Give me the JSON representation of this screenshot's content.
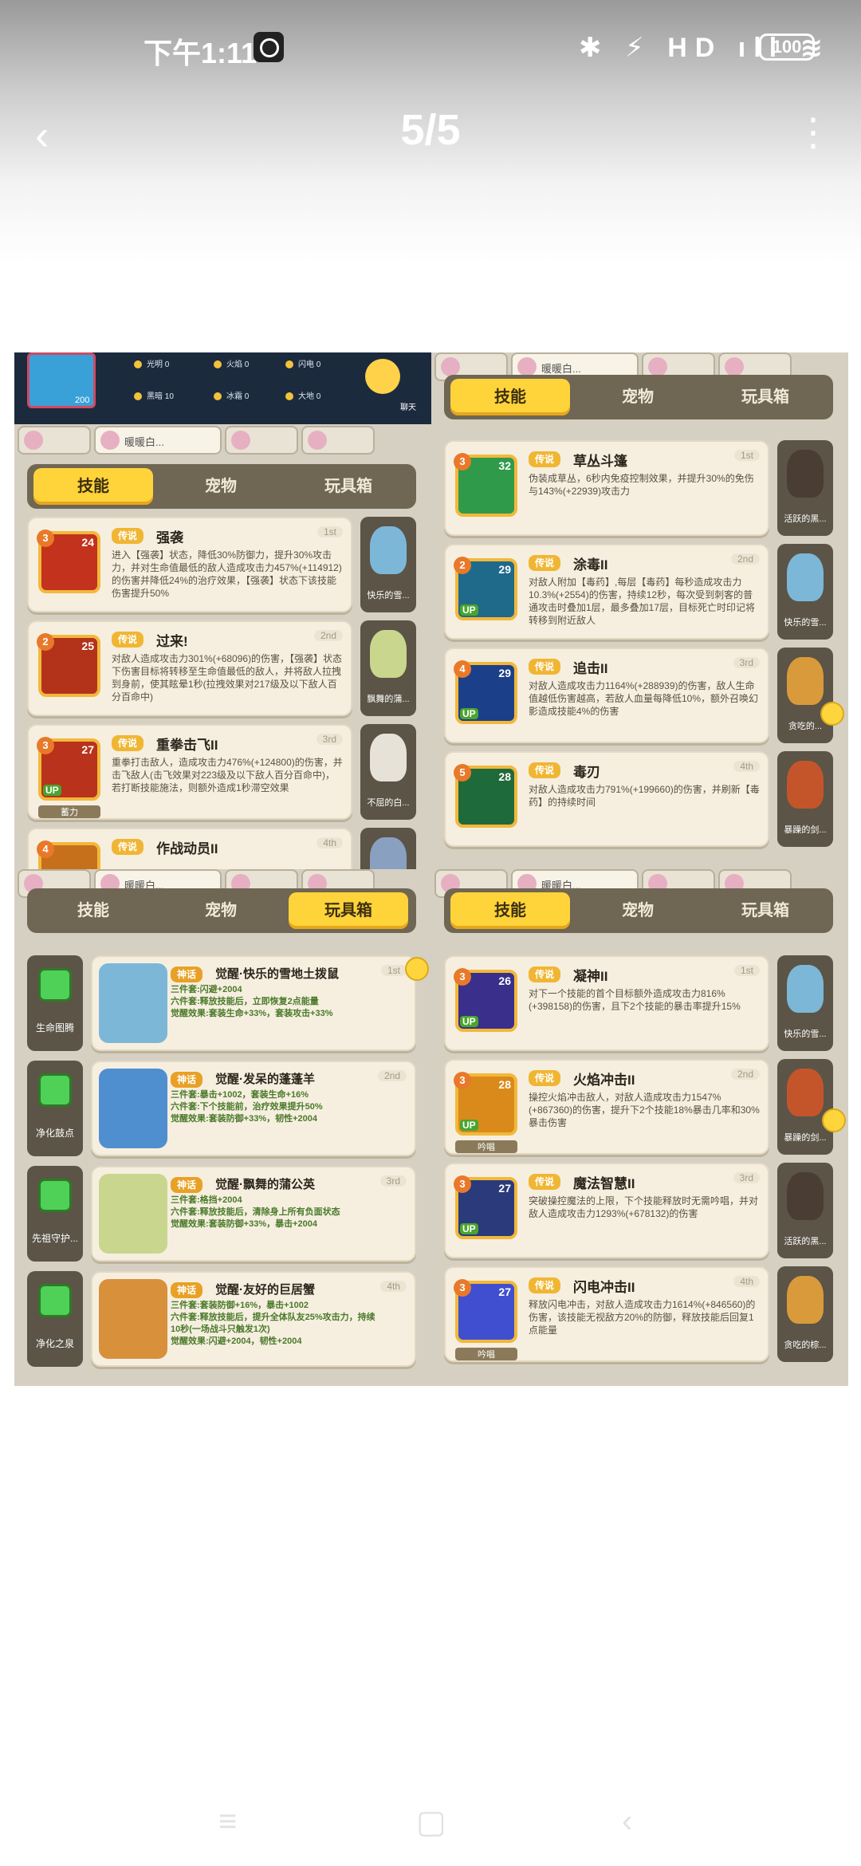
{
  "status_bar": {
    "time": "下午1:11",
    "signal_icons": "✱ ⚡ HD ıll ≋",
    "battery": "100"
  },
  "header": {
    "back_icon": "back-chevron",
    "title": "5/5",
    "more_icon": "vertical-ellipsis"
  },
  "panels": [
    {
      "hud": {
        "avatar_value": "200",
        "stats": [
          "光明 0",
          "火焰 0",
          "闪电 0",
          "黑暗 10",
          "冰霜 0",
          "大地 0"
        ],
        "tag": "聊天"
      },
      "pet_tab_name": "暖暖白...",
      "tabs": [
        "技能",
        "宠物",
        "玩具箱"
      ],
      "active_tab": 0,
      "cards": [
        {
          "level": "3",
          "num": "24",
          "up": "",
          "sub": "",
          "badge": "传说",
          "title": "强袭",
          "rank": "1st",
          "desc": "进入【强袭】状态，降低30%防御力，提升30%攻击力，并对生命值最低的敌人造成攻击力457%(+114912)的伤害并降低24%的治疗效果，【强袭】状态下该技能伤害提升50%",
          "pet": "快乐的雪...",
          "pet_color": "#7db7d8",
          "icon_color": "#c2321c"
        },
        {
          "level": "2",
          "num": "25",
          "up": "",
          "sub": "",
          "badge": "传说",
          "title": "过来!",
          "rank": "2nd",
          "desc": "对敌人造成攻击力301%(+68096)的伤害，【强袭】状态下伤害目标将转移至生命值最低的敌人，并将敌人拉拽到身前，使其眩晕1秒(拉拽效果对217级及以下敌人百分百命中)",
          "pet": "飘舞的蒲...",
          "pet_color": "#c9d68e",
          "icon_color": "#b3331a"
        },
        {
          "level": "3",
          "num": "27",
          "up": "UP",
          "sub": "蓄力",
          "badge": "传说",
          "title": "重拳击飞II",
          "rank": "3rd",
          "desc": "重拳打击敌人，造成攻击力476%(+124800)的伤害，并击飞敌人(击飞效果对223级及以下敌人百分百命中)，若打断技能施法，则额外造成1秒滞空效果",
          "pet": "不屈的白...",
          "pet_color": "#e7e2d8",
          "icon_color": "#b8321c"
        },
        {
          "level": "4",
          "num": "",
          "up": "",
          "sub": "",
          "badge": "传说",
          "title": "作战动员II",
          "rank": "4th",
          "desc": "",
          "pet": "",
          "pet_color": "#8aa0c0",
          "icon_color": "#c7701c"
        }
      ]
    },
    {
      "pet_tab_name": "暖暖白...",
      "tabs": [
        "技能",
        "宠物",
        "玩具箱"
      ],
      "active_tab": 0,
      "cards": [
        {
          "level": "3",
          "num": "32",
          "up": "",
          "sub": "",
          "badge": "传说",
          "title": "草丛斗篷",
          "rank": "1st",
          "desc": "伪装成草丛，6秒内免疫控制效果，并提升30%的免伤与143%(+22939)攻击力",
          "pet": "活跃的黑...",
          "pet_color": "#4a3d34",
          "icon_color": "#2f9a4a"
        },
        {
          "level": "2",
          "num": "29",
          "up": "UP",
          "sub": "",
          "badge": "传说",
          "title": "涂毒II",
          "rank": "2nd",
          "desc": "对敌人附加【毒药】,每层【毒药】每秒造成攻击力10.3%(+2554)的伤害，持续12秒，每次受到刺客的普通攻击时叠加1层，最多叠加17层，目标死亡时印记将转移到附近敌人",
          "pet": "快乐的雪...",
          "pet_color": "#7db7d8",
          "icon_color": "#1f6a8a"
        },
        {
          "level": "4",
          "num": "29",
          "up": "UP",
          "sub": "",
          "badge": "传说",
          "title": "追击II",
          "rank": "3rd",
          "desc": "对敌人造成攻击力1164%(+288939)的伤害，敌人生命值越低伤害越高，若敌人血量每降低10%，额外召唤幻影造成技能4%的伤害",
          "pet": "贪吃的...",
          "pet_color": "#d99a3b",
          "icon_color": "#1c3f8a"
        },
        {
          "level": "5",
          "num": "28",
          "up": "",
          "sub": "",
          "badge": "传说",
          "title": "毒刃",
          "rank": "4th",
          "desc": "对敌人造成攻击力791%(+199660)的伤害，并刷新【毒药】的持续时间",
          "pet": "暴躁的剑...",
          "pet_color": "#c4552b",
          "icon_color": "#1f6a3a"
        }
      ]
    },
    {
      "pet_tab_name": "暖暖白...",
      "tabs": [
        "技能",
        "宠物",
        "玩具箱"
      ],
      "active_tab": 2,
      "toys": [
        {
          "relic": "生命图腾",
          "badge": "神话",
          "title": "觉醒·快乐的雪地土拨鼠",
          "rank": "1st",
          "lines": [
            "三件套:闪避+2004",
            "六件套:释放技能后，立即恢复2点能量",
            "觉醒效果:套装生命+33%，套装攻击+33%"
          ],
          "fig_color": "#7db7d8"
        },
        {
          "relic": "净化鼓点",
          "badge": "神话",
          "title": "觉醒·发呆的蓬蓬羊",
          "rank": "2nd",
          "lines": [
            "三件套:暴击+1002，套装生命+16%",
            "六件套:下个技能前，治疗效果提升50%",
            "觉醒效果:套装防御+33%，韧性+2004"
          ],
          "fig_color": "#4f8fd0"
        },
        {
          "relic": "先祖守护...",
          "badge": "神话",
          "title": "觉醒·飘舞的蒲公英",
          "rank": "3rd",
          "lines": [
            "三件套:格挡+2004",
            "六件套:释放技能后，清除身上所有负面状态",
            "觉醒效果:套装防御+33%，暴击+2004"
          ],
          "fig_color": "#c9d68e"
        },
        {
          "relic": "净化之泉",
          "badge": "神话",
          "title": "觉醒·友好的巨居蟹",
          "rank": "4th",
          "lines": [
            "三件套:套装防御+16%，暴击+1002",
            "六件套:释放技能后，提升全体队友25%攻击力，持续10秒(一场战斗只触发1次)",
            "觉醒效果:闪避+2004，韧性+2004"
          ],
          "fig_color": "#d9903b"
        }
      ]
    },
    {
      "pet_tab_name": "暖暖白...",
      "tabs": [
        "技能",
        "宠物",
        "玩具箱"
      ],
      "active_tab": 0,
      "cards": [
        {
          "level": "3",
          "num": "26",
          "up": "UP",
          "sub": "",
          "badge": "传说",
          "title": "凝神II",
          "rank": "1st",
          "desc": "对下一个技能的首个目标额外造成攻击力816%(+398158)的伤害，且下2个技能的暴击率提升15%",
          "pet": "快乐的雪...",
          "pet_color": "#7db7d8",
          "icon_color": "#3a2f8a"
        },
        {
          "level": "3",
          "num": "28",
          "up": "UP",
          "sub": "吟唱",
          "badge": "传说",
          "title": "火焰冲击II",
          "rank": "2nd",
          "desc": "操控火焰冲击敌人，对敌人造成攻击力1547%(+867360)的伤害，提升下2个技能18%暴击几率和30%暴击伤害",
          "pet": "暴躁的剑...",
          "pet_color": "#c4552b",
          "icon_color": "#d98a1a"
        },
        {
          "level": "3",
          "num": "27",
          "up": "UP",
          "sub": "",
          "badge": "传说",
          "title": "魔法智慧II",
          "rank": "3rd",
          "desc": "突破操控魔法的上限，下个技能释放时无需吟唱，并对敌人造成攻击力1293%(+678132)的伤害",
          "pet": "活跃的黑...",
          "pet_color": "#4a3d34",
          "icon_color": "#2a3a7a"
        },
        {
          "level": "3",
          "num": "27",
          "up": "",
          "sub": "吟唱",
          "badge": "传说",
          "title": "闪电冲击II",
          "rank": "4th",
          "desc": "释放闪电冲击，对敌人造成攻击力1614%(+846560)的伤害，该技能无视敌方20%的防御，释放技能后回复1点能量",
          "pet": "贪吃的棕...",
          "pet_color": "#d99a3b",
          "icon_color": "#3f4fd0"
        }
      ]
    }
  ],
  "nav": {
    "menu_icon": "≡",
    "home_icon": "▢",
    "back_icon": "‹"
  }
}
